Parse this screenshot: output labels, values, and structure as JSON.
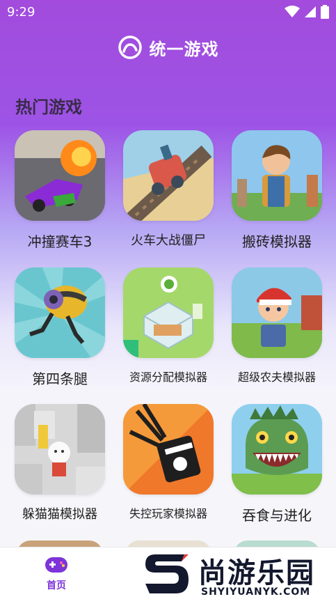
{
  "status_bar": {
    "time": "9:29"
  },
  "header": {
    "title": "统一游戏"
  },
  "section": {
    "title": "热门游戏"
  },
  "games": [
    {
      "label": "冲撞赛车3"
    },
    {
      "label": "火车大战僵尸"
    },
    {
      "label": "搬砖模拟器"
    },
    {
      "label": "第四条腿"
    },
    {
      "label": "资源分配模拟器"
    },
    {
      "label": "超级农夫模拟器"
    },
    {
      "label": "躲猫猫模拟器"
    },
    {
      "label": "失控玩家模拟器"
    },
    {
      "label": "吞食与进化"
    }
  ],
  "bottom_nav": {
    "home_label": "首页"
  },
  "watermark": {
    "text": "尚游乐园",
    "url": "SHYIYUANYK.COM"
  },
  "colors": {
    "accent": "#7d34d8",
    "header_gradient_top": "#a24bdc"
  }
}
